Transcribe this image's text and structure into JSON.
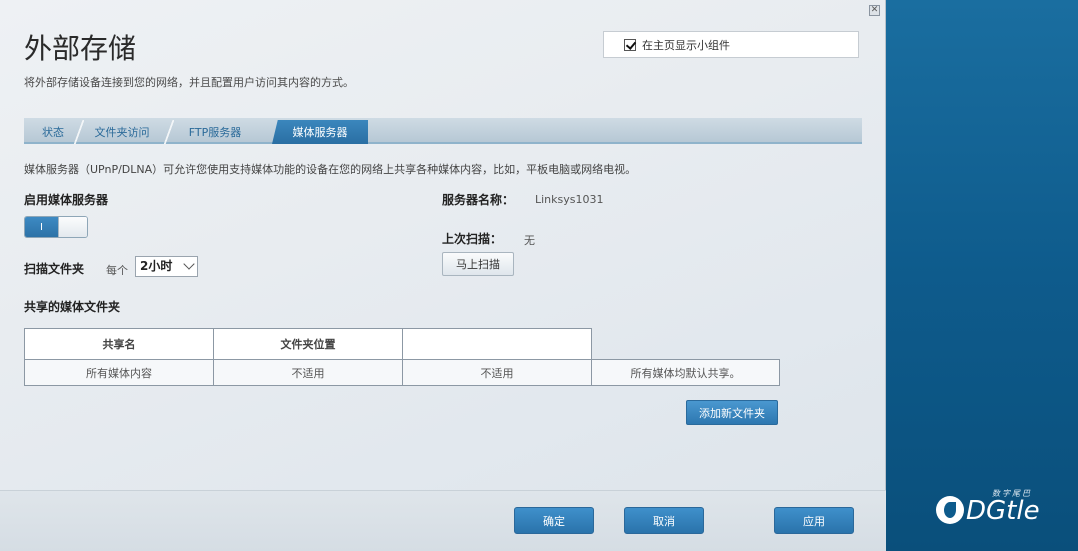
{
  "dialog": {
    "title": "外部存储",
    "subtitle": "将外部存储设备连接到您的网络，并且配置用户访问其内容的方式。",
    "close_symbol": "✕",
    "show_widget_label": "在主页显示小组件",
    "show_widget_checked": true
  },
  "tabs": [
    {
      "label": "状态",
      "active": false
    },
    {
      "label": "文件夹访问",
      "active": false
    },
    {
      "label": "FTP服务器",
      "active": false
    },
    {
      "label": "媒体服务器",
      "active": true
    }
  ],
  "media": {
    "description": "媒体服务器（UPnP/DLNA）可允许您使用支持媒体功能的设备在您的网络上共享各种媒体内容，比如，平板电脑或网络电视。",
    "enable_label": "启用媒体服务器",
    "toggle_text": "I",
    "scan_label": "扫描文件夹",
    "scan_every": "每个",
    "scan_interval": "2小时",
    "server_name_label": "服务器名称：",
    "server_name_value": "Linksys1031",
    "last_scan_label": "上次扫描：",
    "last_scan_value": "无",
    "scan_now_button": "马上扫描",
    "shared_folders_label": "共享的媒体文件夹"
  },
  "table": {
    "headers": [
      "共享名",
      "文件夹位置",
      ""
    ],
    "rows": [
      [
        "所有媒体内容",
        "不适用",
        "不适用",
        "所有媒体均默认共享。"
      ]
    ]
  },
  "add_folder_button": "添加新文件夹",
  "footer": {
    "ok": "确定",
    "cancel": "取消",
    "apply": "应用"
  },
  "branding": {
    "name": "DGtle",
    "sub": "数字尾巴"
  },
  "colors": {
    "accent": "#2d77b0",
    "background_right": "#0e5b8c"
  }
}
